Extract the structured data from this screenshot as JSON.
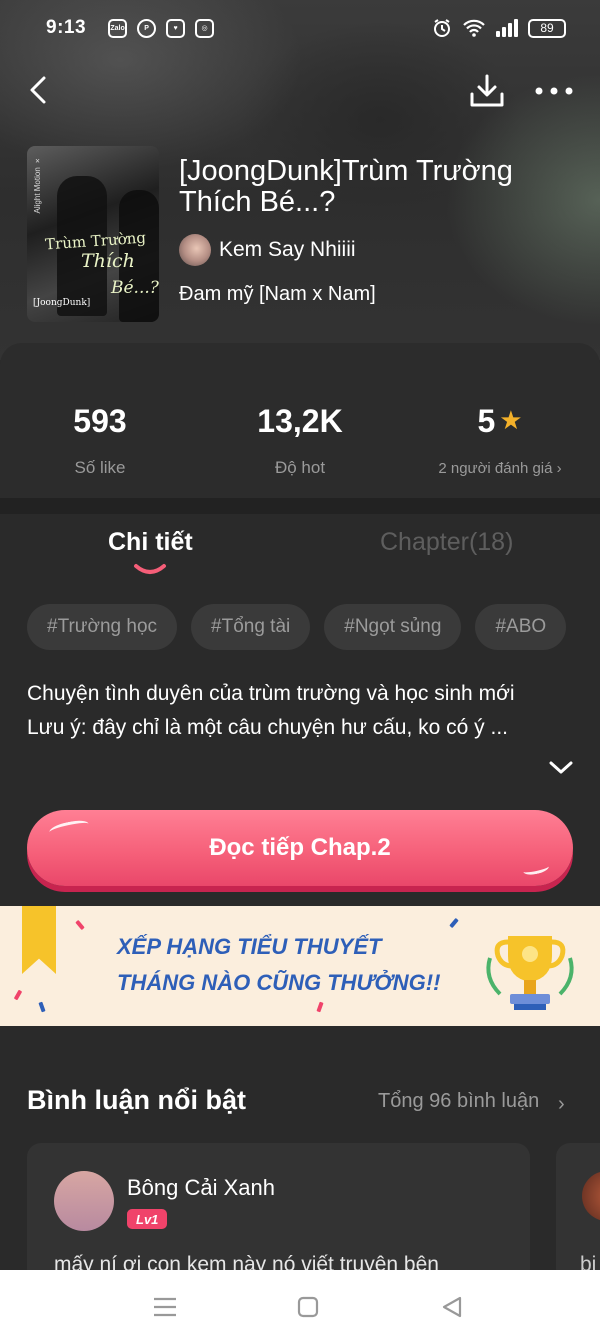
{
  "status_bar": {
    "time": "9:13",
    "notification_icons": [
      "zalo-icon",
      "pinterest-icon",
      "heart-app-icon",
      "instagram-icon"
    ],
    "zalo_label": "Zalo",
    "battery": "89"
  },
  "book": {
    "title": "[JoongDunk]Trùm Trường Thích Bé...?",
    "author": "Kem Say Nhiiii",
    "genre": "Đam mỹ [Nam x Nam]",
    "cover": {
      "side_text": "Alight Motion ×",
      "title_line1": "Trùm Trường",
      "title_line2": "Thích",
      "title_line3": "Bé...?",
      "tag": "[JoongDunk]"
    }
  },
  "stats": [
    {
      "value": "593",
      "label": "Số like"
    },
    {
      "value": "13,2K",
      "label": "Độ hot"
    },
    {
      "value": "5",
      "label": "2 người đánh giá",
      "chevron": "›"
    }
  ],
  "tabs": [
    {
      "label": "Chi tiết",
      "active": true
    },
    {
      "label": "Chapter(18)",
      "active": false
    }
  ],
  "tags": [
    "#Trường học",
    "#Tổng tài",
    "#Ngọt sủng",
    "#ABO"
  ],
  "description": {
    "line1": "Chuyện tình duyên của trùm trường và học sinh mới",
    "line2": "Lưu ý: đây chỉ là một câu chuyện hư cấu, ko có ý ..."
  },
  "read_button": "Đọc tiếp Chap.2",
  "banner": {
    "line1": "XẾP HẠNG TIỂU THUYẾT",
    "line2": "THÁNG NÀO CŨNG THƯỞNG!!"
  },
  "comments": {
    "heading": "Bình luận nổi bật",
    "total": "Tổng 96 bình luận",
    "chevron": "›",
    "items": [
      {
        "user": "Bông Cải Xanh",
        "level": "Lv1",
        "text": "mấy ní ơi con kem này nó viết truyện bên"
      },
      {
        "text": "bi"
      }
    ]
  },
  "colors": {
    "accent": "#f55e78",
    "star": "#f3b12a",
    "banner_text": "#2e5fb8"
  }
}
